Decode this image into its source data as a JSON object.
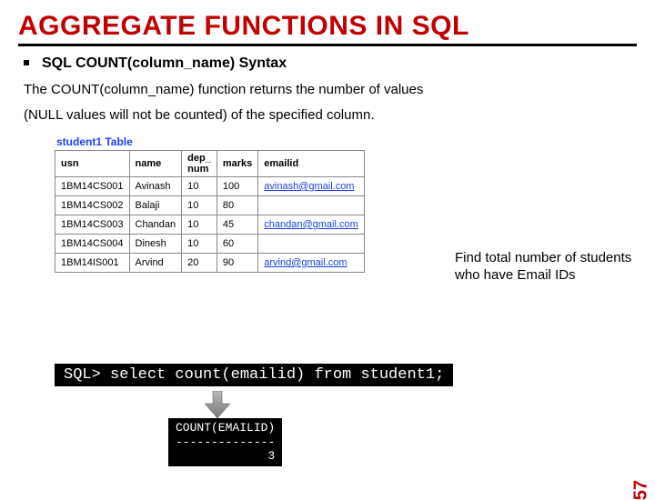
{
  "title": "AGGREGATE FUNCTIONS IN SQL",
  "subhead": "SQL COUNT(column_name) Syntax",
  "desc1": "The COUNT(column_name) function returns the number of values",
  "desc2": "(NULL values will not be counted) of the specified column.",
  "table": {
    "caption": "student1 Table",
    "headers": [
      "usn",
      "name",
      "dep_\nnum",
      "marks",
      "emailid"
    ],
    "rows": [
      [
        "1BM14CS001",
        "Avinash",
        "10",
        "100",
        "avinash@gmail.com"
      ],
      [
        "1BM14CS002",
        "Balaji",
        "10",
        "80",
        ""
      ],
      [
        "1BM14CS003",
        "Chandan",
        "10",
        "45",
        "chandan@gmail.com"
      ],
      [
        "1BM14CS004",
        "Dinesh",
        "10",
        "60",
        ""
      ],
      [
        "1BM14IS001",
        "Arvind",
        "20",
        "90",
        "arvind@gmail.com"
      ]
    ]
  },
  "callout": "Find total number of students who have Email IDs",
  "sql_prompt": "SQL> select count(emailid) from student1;",
  "result": {
    "header": "COUNT(EMAILID)",
    "divider": "--------------",
    "value": "             3"
  },
  "page_number": "57"
}
